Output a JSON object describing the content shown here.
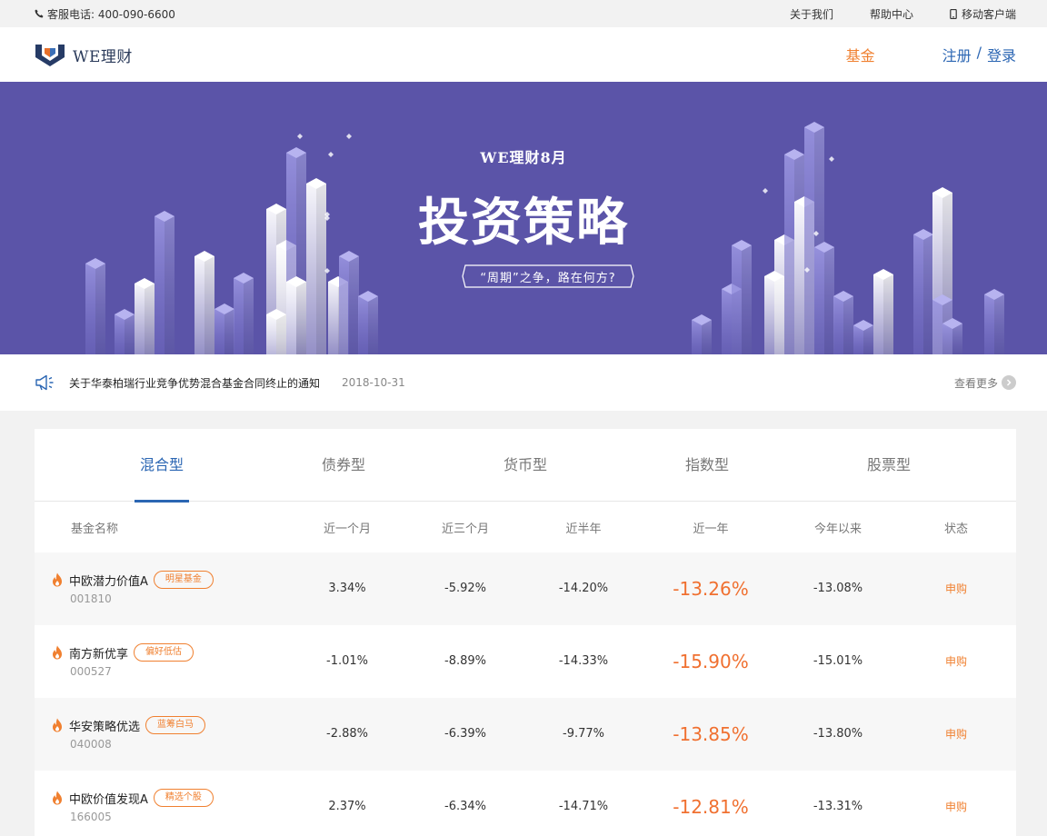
{
  "topbar": {
    "phone_label": "客服电话: 400-090-6600",
    "links": [
      "关于我们",
      "帮助中心",
      "移动客户端"
    ]
  },
  "header": {
    "logo_text": "WE理财",
    "nav_fund": "基金",
    "register": "注册",
    "separator": "/",
    "login": "登录"
  },
  "banner": {
    "subtitle": "WE理财8月",
    "title": "投资策略",
    "slogan": "“周期”之争，路在何方?"
  },
  "notice": {
    "text": "关于华泰柏瑞行业竞争优势混合基金合同终止的通知",
    "date": "2018-10-31",
    "more": "查看更多"
  },
  "fund_panel": {
    "tabs": [
      {
        "label": "混合型",
        "active": true
      },
      {
        "label": "债券型",
        "active": false
      },
      {
        "label": "货币型",
        "active": false
      },
      {
        "label": "指数型",
        "active": false
      },
      {
        "label": "股票型",
        "active": false
      }
    ],
    "columns": [
      "基金名称",
      "近一个月",
      "近三个月",
      "近半年",
      "近一年",
      "今年以来",
      "状态"
    ],
    "rows": [
      {
        "name": "中欧潜力价值A",
        "tag": "明星基金",
        "code": "001810",
        "m1": "3.34%",
        "m3": "-5.92%",
        "m6": "-14.20%",
        "y1": "-13.26%",
        "ytd": "-13.08%",
        "action": "申购"
      },
      {
        "name": "南方新优享",
        "tag": "偏好低估",
        "code": "000527",
        "m1": "-1.01%",
        "m3": "-8.89%",
        "m6": "-14.33%",
        "y1": "-15.90%",
        "ytd": "-15.01%",
        "action": "申购"
      },
      {
        "name": "华安策略优选",
        "tag": "蓝筹白马",
        "code": "040008",
        "m1": "-2.88%",
        "m3": "-6.39%",
        "m6": "-9.77%",
        "y1": "-13.85%",
        "ytd": "-13.80%",
        "action": "申购"
      },
      {
        "name": "中欧价值发现A",
        "tag": "精选个股",
        "code": "166005",
        "m1": "2.37%",
        "m3": "-6.34%",
        "m6": "-14.71%",
        "y1": "-12.81%",
        "ytd": "-13.31%",
        "action": "申购"
      }
    ]
  },
  "colors": {
    "brand_blue": "#2b66b3",
    "accent_orange": "#f08030",
    "banner_bg": "#5b54a8"
  }
}
